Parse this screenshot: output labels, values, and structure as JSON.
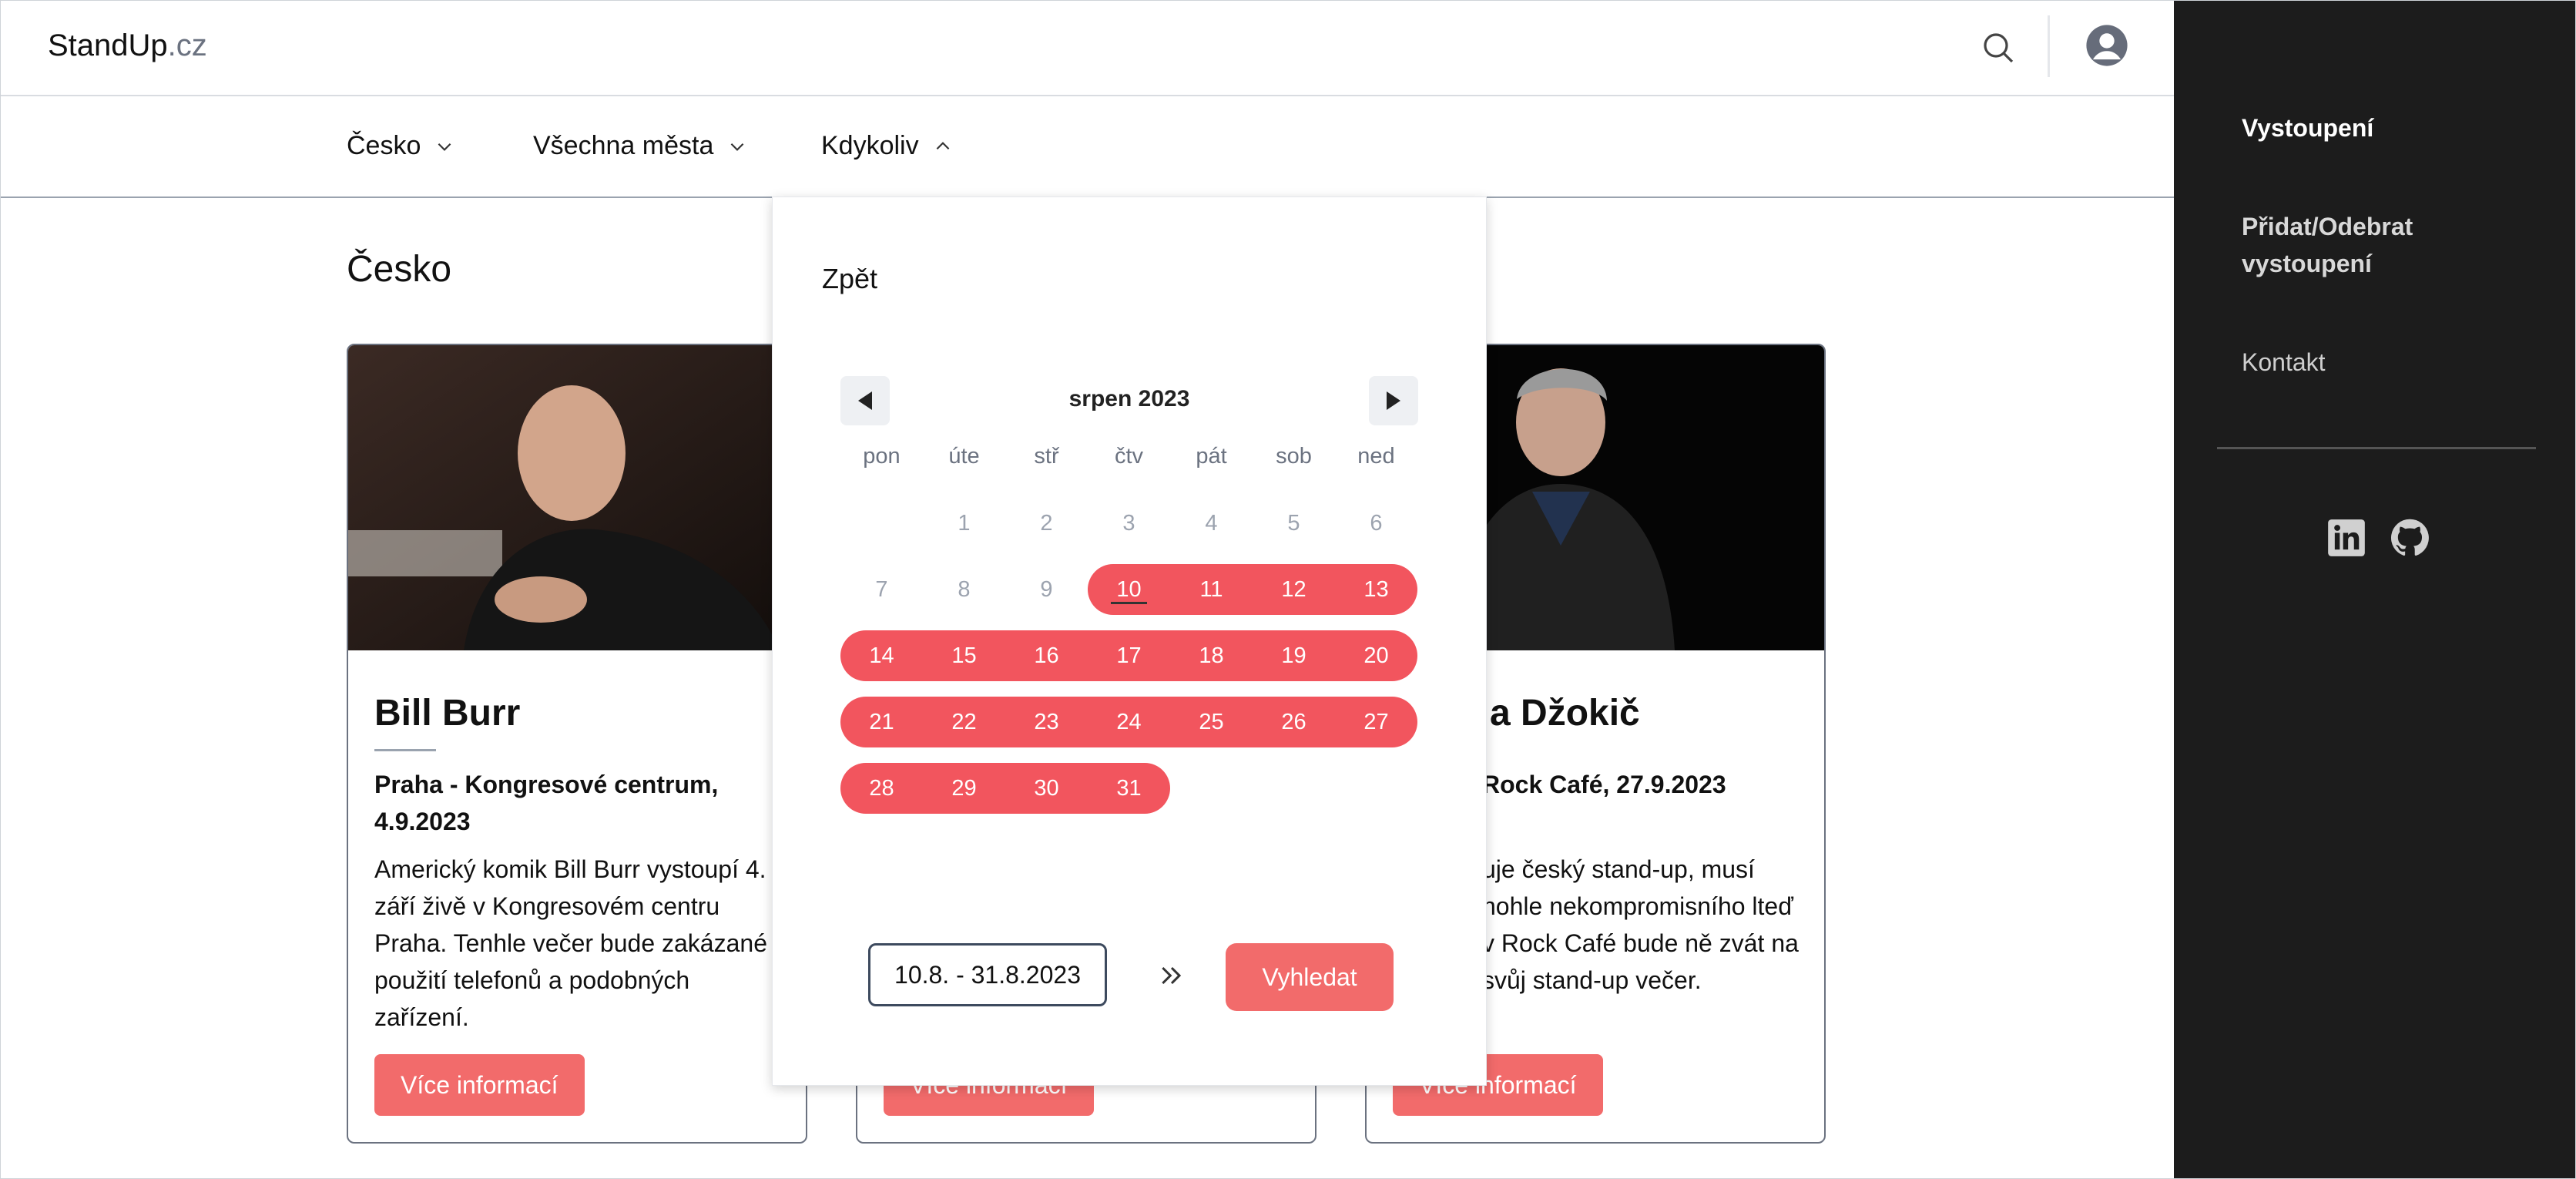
{
  "header": {
    "brand_main": "StandUp",
    "brand_suffix": ".cz"
  },
  "filters": [
    {
      "label": "Česko",
      "state": "collapsed"
    },
    {
      "label": "Všechna města",
      "state": "collapsed"
    },
    {
      "label": "Kdykoliv",
      "state": "expanded"
    }
  ],
  "section_title": "Česko",
  "cards": [
    {
      "title": "Bill Burr",
      "venue": "Praha - Kongresové centrum, 4.9.2023",
      "description": "Americký komik Bill Burr vystoupí 4. září živě v Kongresovém centru Praha. Tenhle večer bude zakázané použití telefonů a podobných zařízení.",
      "button": "Více informací"
    },
    {
      "title": "",
      "venue": "",
      "description": "",
      "button": "Více informací"
    },
    {
      "title": "a Džokič",
      "venue": "Rock Café, 27.9.2023",
      "description": "uje český stand-up, musí nohle nekompromisního lteď v Rock Café bude ně zvát na svůj stand-up večer.",
      "button": "Více informací"
    }
  ],
  "datepicker": {
    "back": "Zpět",
    "month": "srpen 2023",
    "weekdays": [
      "pon",
      "úte",
      "stř",
      "čtv",
      "pát",
      "sob",
      "ned"
    ],
    "days_in_month": 31,
    "first_weekday_index": 1,
    "range_start": 10,
    "range_end": 31,
    "today": 10,
    "date_range_value": "10.8. - 31.8.2023",
    "search_button": "Vyhledat",
    "range_color": "#f2555e"
  },
  "sidebar": {
    "links": [
      "Vystoupení",
      "Přidat/Odebrat vystoupení",
      "Kontakt"
    ],
    "social": [
      "linkedin-icon",
      "github-icon"
    ]
  },
  "colors": {
    "accent": "#f26b6b",
    "sidebar_bg": "#1c1c1c"
  }
}
